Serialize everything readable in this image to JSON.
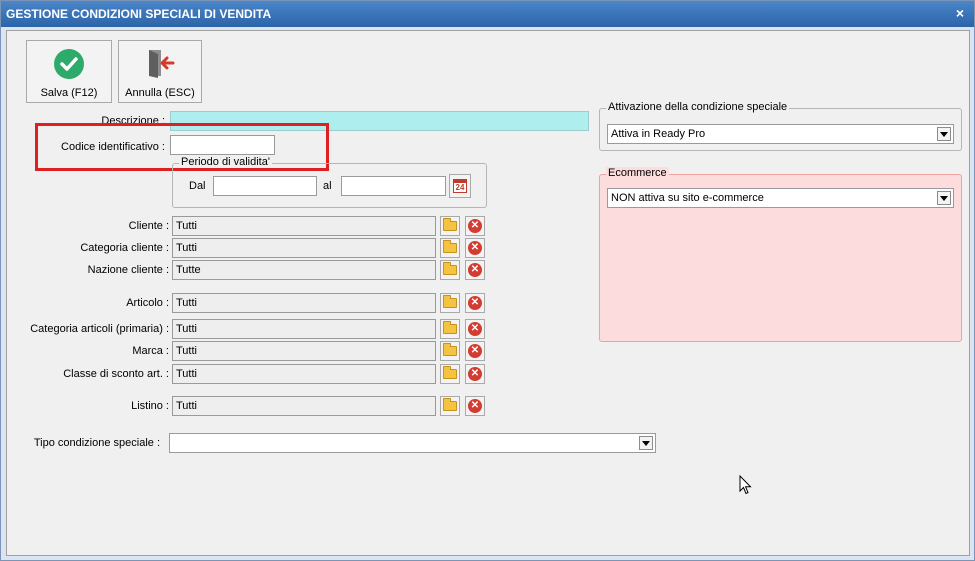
{
  "window": {
    "title": "GESTIONE CONDIZIONI SPECIALI DI VENDITA",
    "close_glyph": "×"
  },
  "toolbar": {
    "save_label": "Salva (F12)",
    "save_icon": "check-circle-icon",
    "cancel_label": "Annulla (ESC)",
    "cancel_icon": "exit-door-icon",
    "accent": "#2eaa6a"
  },
  "form": {
    "descrizione_label": "Descrizione :",
    "descrizione_value": "",
    "codice_label": "Codice identificativo :",
    "codice_value": "",
    "periodo_title": "Periodo di validita'",
    "dal_label": "Dal",
    "dal_value": "",
    "al_label": "al",
    "al_value": "",
    "calendar_day": "24",
    "filters": [
      {
        "label": "Cliente :",
        "value": "Tutti"
      },
      {
        "label": "Categoria cliente :",
        "value": "Tutti"
      },
      {
        "label": "Nazione cliente :",
        "value": "Tutte"
      },
      {
        "label": "Articolo :",
        "value": "Tutti"
      },
      {
        "label": "Categoria articoli (primaria) :",
        "value": "Tutti"
      },
      {
        "label": "Marca :",
        "value": "Tutti"
      },
      {
        "label": "Classe di sconto art. :",
        "value": "Tutti"
      },
      {
        "label": "Listino :",
        "value": "Tutti"
      }
    ],
    "tipo_label": "Tipo condizione speciale :",
    "tipo_value": ""
  },
  "attivazione": {
    "title": "Attivazione della condizione speciale",
    "value": "Attiva in Ready Pro"
  },
  "ecommerce": {
    "title": "Ecommerce",
    "value": "NON attiva su sito e-commerce",
    "bg": "#fcdcdc",
    "border": "#f0a0a0"
  }
}
